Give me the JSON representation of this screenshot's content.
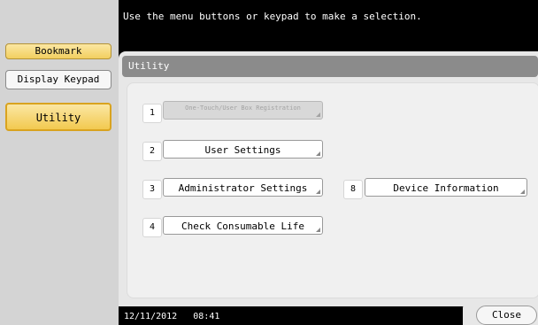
{
  "sidebar": {
    "bookmark": "Bookmark",
    "display_keypad": "Display Keypad",
    "utility": "Utility"
  },
  "message": "Use the menu buttons or keypad to make a selection.",
  "panel": {
    "title": "Utility",
    "items": [
      {
        "num": "1",
        "label": "One-Touch/User Box Registration",
        "enabled": false
      },
      {
        "num": "2",
        "label": "User Settings",
        "enabled": true
      },
      {
        "num": "3",
        "label": "Administrator Settings",
        "enabled": true
      },
      {
        "num": "8",
        "label": "Device Information",
        "enabled": true
      },
      {
        "num": "4",
        "label": "Check Consumable Life",
        "enabled": true
      }
    ]
  },
  "footer": {
    "date": "12/11/2012",
    "time": "08:41",
    "close": "Close"
  }
}
